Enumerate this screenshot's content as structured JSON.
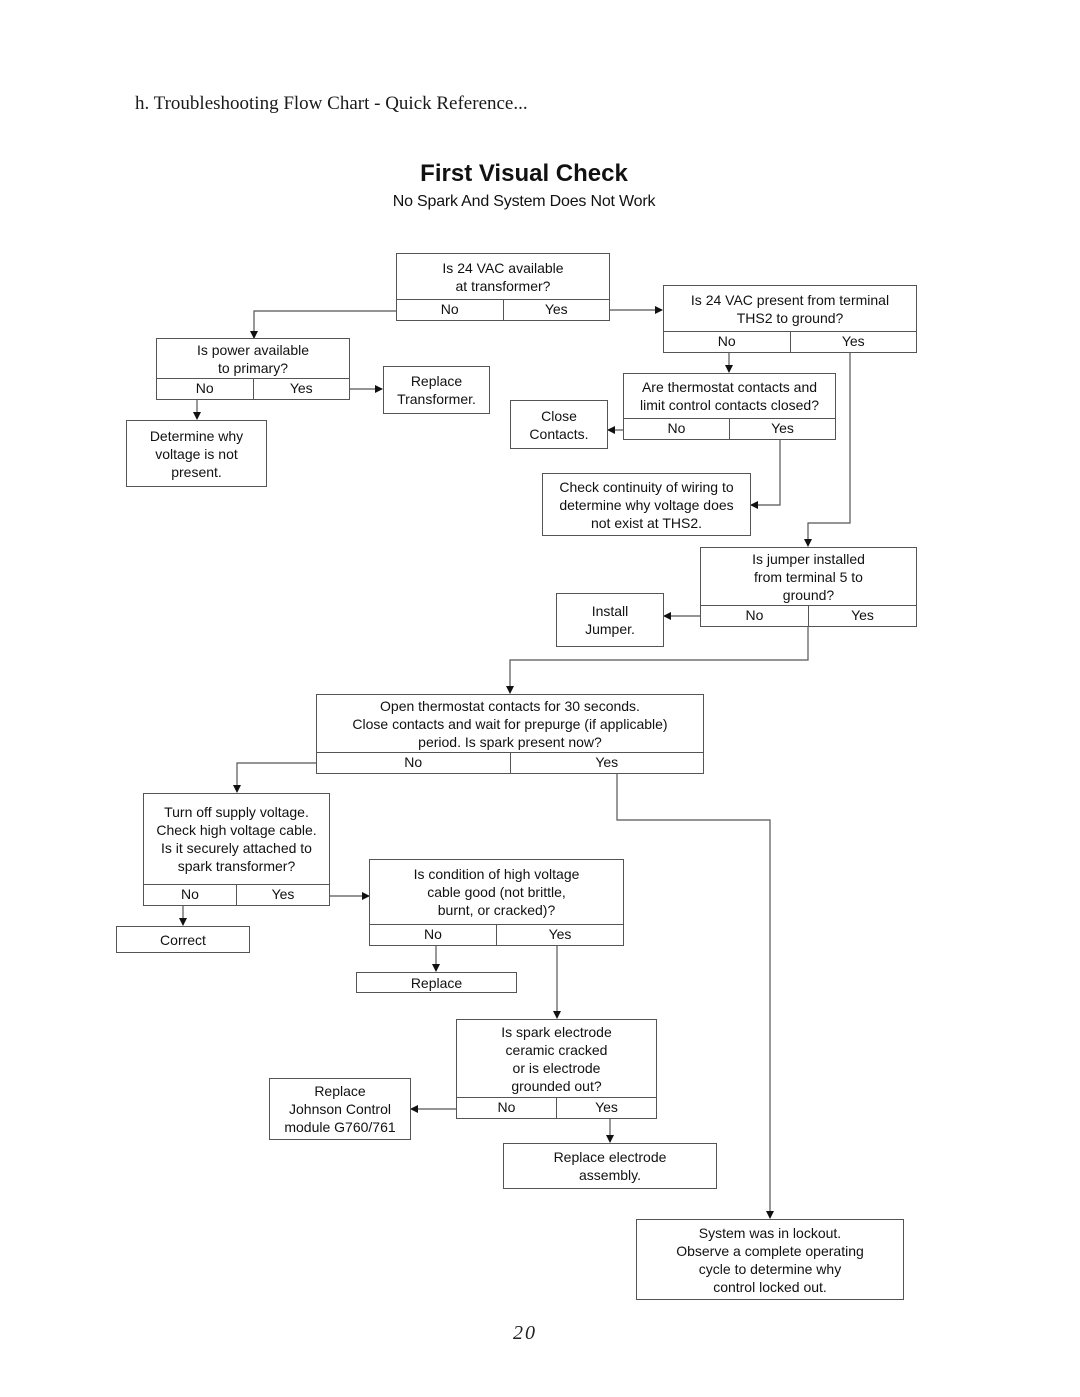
{
  "document": {
    "section_heading": "h.  Troubleshooting Flow Chart - Quick Reference...",
    "title": "First Visual Check",
    "subtitle": "No Spark And System Does Not Work",
    "page_number": "20"
  },
  "answers": {
    "no": "No",
    "yes": "Yes"
  },
  "decisions": {
    "d1": "Is 24 VAC available\nat transformer?",
    "d2": "Is power available\nto primary?",
    "d3": "Is 24 VAC present from terminal\nTHS2 to ground?",
    "d4": "Are thermostat contacts and\nlimit control contacts closed?",
    "d5": "Is jumper installed\nfrom terminal 5 to\nground?",
    "d6": "Open thermostat contacts for 30 seconds.\nClose contacts and wait for prepurge (if applicable)\nperiod.  Is spark present now?",
    "d7": "Turn off supply voltage.\nCheck high voltage cable.\nIs it securely attached to\nspark transformer?",
    "d8": "Is condition of high voltage\ncable good (not brittle,\nburnt, or cracked)?",
    "d9": "Is spark electrode\nceramic cracked\nor is electrode\ngrounded out?"
  },
  "actions": {
    "a1": "Determine why\nvoltage is not\npresent.",
    "a2": "Replace\nTransformer.",
    "a3": "Close\nContacts.",
    "a4": "Check continuity of wiring to\ndetermine why voltage does\nnot exist at THS2.",
    "a5": "Install\nJumper.",
    "a6": "Correct",
    "a7": "Replace",
    "a8": "Replace\nJohnson Control\nmodule G760/761",
    "a9": "Replace electrode\nassembly.",
    "a10": "System was in lockout.\nObserve a complete operating\ncycle to determine why\ncontrol locked out."
  },
  "flow": [
    {
      "from": "d1",
      "answer": "No",
      "to": "d2"
    },
    {
      "from": "d1",
      "answer": "Yes",
      "to": "d3"
    },
    {
      "from": "d2",
      "answer": "No",
      "to": "a1"
    },
    {
      "from": "d2",
      "answer": "Yes",
      "to": "a2"
    },
    {
      "from": "d3",
      "answer": "No",
      "to": "d4"
    },
    {
      "from": "d3",
      "answer": "Yes",
      "to": "d5"
    },
    {
      "from": "d4",
      "answer": "No",
      "to": "a3"
    },
    {
      "from": "d4",
      "answer": "Yes",
      "to": "a4"
    },
    {
      "from": "d5",
      "answer": "No",
      "to": "a5"
    },
    {
      "from": "d5",
      "answer": "Yes",
      "to": "d6"
    },
    {
      "from": "d6",
      "answer": "No",
      "to": "d7"
    },
    {
      "from": "d6",
      "answer": "Yes",
      "to": "a10"
    },
    {
      "from": "d7",
      "answer": "No",
      "to": "a6"
    },
    {
      "from": "d7",
      "answer": "Yes",
      "to": "d8"
    },
    {
      "from": "d8",
      "answer": "No",
      "to": "a7"
    },
    {
      "from": "d8",
      "answer": "Yes",
      "to": "d9"
    },
    {
      "from": "d9",
      "answer": "No",
      "to": "a8"
    },
    {
      "from": "d9",
      "answer": "Yes",
      "to": "a9"
    }
  ]
}
